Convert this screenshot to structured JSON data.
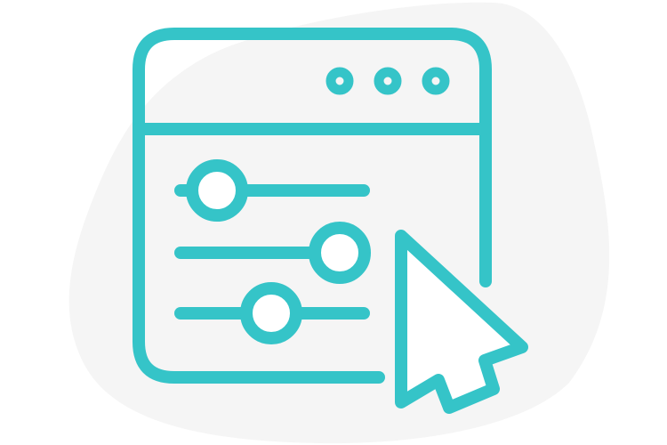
{
  "illustration": {
    "icon": "browser-window-settings-sliders-with-cursor-icon",
    "colors": {
      "stroke": "#35c4c8",
      "blob": "#f5f5f5",
      "background": "#ffffff"
    },
    "window_dots_count": 3,
    "sliders": [
      {
        "label": "",
        "level": 0.2
      },
      {
        "label": "",
        "level": 0.85
      },
      {
        "label": "",
        "level": 0.48
      }
    ]
  }
}
